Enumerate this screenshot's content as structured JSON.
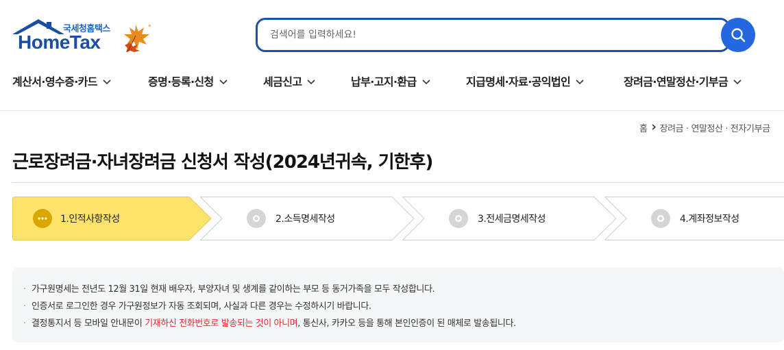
{
  "header": {
    "logo_sub": "국세청홈택스",
    "logo_main": "HomeTax",
    "search": {
      "placeholder": "검색어를 입력하세요!",
      "button_icon": "search-icon"
    }
  },
  "gnb": {
    "items": [
      {
        "label": "계산서·영수증·카드"
      },
      {
        "label": "증명·등록·신청"
      },
      {
        "label": "세금신고"
      },
      {
        "label": "납부·고지·환급"
      },
      {
        "label": "지급명세·자료·공익법인"
      },
      {
        "label": "장려금·연말정산·기부금"
      }
    ]
  },
  "breadcrumb": {
    "home": "홈",
    "items": [
      "장려금 · 연말정산 · 전자기부금"
    ]
  },
  "page_title": "근로장려금·자녀장려금 신청서 작성(2024년귀속, 기한후)",
  "steps": [
    {
      "label": "1.인적사항작성",
      "active": true
    },
    {
      "label": "2.소득명세작성",
      "active": false
    },
    {
      "label": "3.전세금명세작성",
      "active": false
    },
    {
      "label": "4.계좌정보작성",
      "active": false
    }
  ],
  "notice": {
    "line1": "가구원명세는 전년도 12월 31일 현재 배우자, 부양자녀 및 생계를 같이하는 부모 등 동거가족을 모두 작성합니다.",
    "line2": "인증서로 로그인한 경우 가구원정보가 자동 조회되며, 사실과 다른 경우는 수정하시기 바랍니다.",
    "line3_pre": "결정통지서 등 모바일 안내문이 ",
    "line3_warn": "기재하신 전화번호로 발송되는 것이 아니며",
    "line3_post": ", 통신사, 카카오 등을 통해 본인인증이 된 매체로 발송됩니다."
  },
  "colors": {
    "brand": "#1b4ea3",
    "search_border": "#1d4fa6",
    "search_button": "#2467e0",
    "active_step": "#fde36b",
    "active_step_icon": "#d8a800",
    "warn_text": "#e02b2b"
  }
}
